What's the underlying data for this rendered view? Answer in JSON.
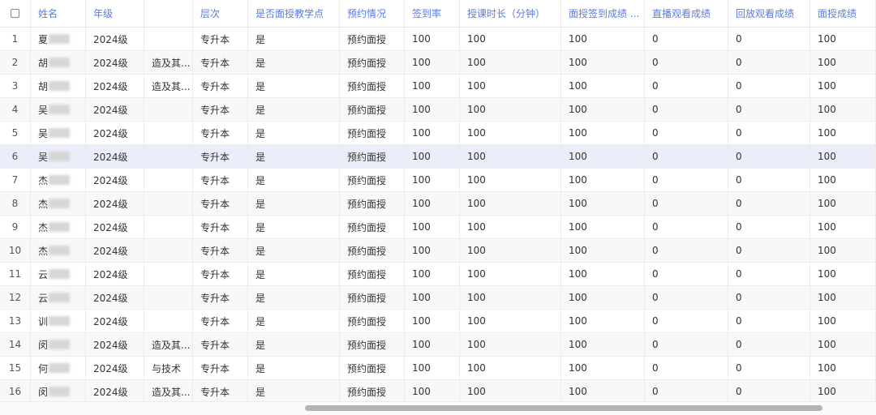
{
  "columns": [
    {
      "key": "checkbox",
      "label": ""
    },
    {
      "key": "name",
      "label": "姓名"
    },
    {
      "key": "grade",
      "label": "年级"
    },
    {
      "key": "major",
      "label": ""
    },
    {
      "key": "level",
      "label": "层次"
    },
    {
      "key": "is_site",
      "label": "是否面授教学点"
    },
    {
      "key": "booking",
      "label": "预约情况"
    },
    {
      "key": "signin_rate",
      "label": "签到率"
    },
    {
      "key": "duration",
      "label": "授课时长（分钟）"
    },
    {
      "key": "signin_score",
      "label": "面授签到成绩 ..."
    },
    {
      "key": "live_score",
      "label": "直播观看成绩"
    },
    {
      "key": "replay_score",
      "label": "回放观看成绩"
    },
    {
      "key": "face_score",
      "label": "面授成绩"
    }
  ],
  "rows": [
    {
      "idx": "1",
      "name": "夏",
      "grade": "2024级",
      "major": "",
      "level": "专升本",
      "is_site": "是",
      "booking": "预约面授",
      "signin_rate": "100",
      "duration": "100",
      "signin_score": "100",
      "live_score": "0",
      "replay_score": "0",
      "face_score": "100"
    },
    {
      "idx": "2",
      "name": "胡",
      "grade": "2024级",
      "major": "造及其...",
      "level": "专升本",
      "is_site": "是",
      "booking": "预约面授",
      "signin_rate": "100",
      "duration": "100",
      "signin_score": "100",
      "live_score": "0",
      "replay_score": "0",
      "face_score": "100"
    },
    {
      "idx": "3",
      "name": "胡",
      "grade": "2024级",
      "major": "造及其...",
      "level": "专升本",
      "is_site": "是",
      "booking": "预约面授",
      "signin_rate": "100",
      "duration": "100",
      "signin_score": "100",
      "live_score": "0",
      "replay_score": "0",
      "face_score": "100"
    },
    {
      "idx": "4",
      "name": "吴",
      "grade": "2024级",
      "major": "",
      "level": "专升本",
      "is_site": "是",
      "booking": "预约面授",
      "signin_rate": "100",
      "duration": "100",
      "signin_score": "100",
      "live_score": "0",
      "replay_score": "0",
      "face_score": "100"
    },
    {
      "idx": "5",
      "name": "吴",
      "grade": "2024级",
      "major": "",
      "level": "专升本",
      "is_site": "是",
      "booking": "预约面授",
      "signin_rate": "100",
      "duration": "100",
      "signin_score": "100",
      "live_score": "0",
      "replay_score": "0",
      "face_score": "100"
    },
    {
      "idx": "6",
      "name": "吴",
      "grade": "2024级",
      "major": "",
      "level": "专升本",
      "is_site": "是",
      "booking": "预约面授",
      "signin_rate": "100",
      "duration": "100",
      "signin_score": "100",
      "live_score": "0",
      "replay_score": "0",
      "face_score": "100"
    },
    {
      "idx": "7",
      "name": "杰",
      "grade": "2024级",
      "major": "",
      "level": "专升本",
      "is_site": "是",
      "booking": "预约面授",
      "signin_rate": "100",
      "duration": "100",
      "signin_score": "100",
      "live_score": "0",
      "replay_score": "0",
      "face_score": "100"
    },
    {
      "idx": "8",
      "name": "杰",
      "grade": "2024级",
      "major": "",
      "level": "专升本",
      "is_site": "是",
      "booking": "预约面授",
      "signin_rate": "100",
      "duration": "100",
      "signin_score": "100",
      "live_score": "0",
      "replay_score": "0",
      "face_score": "100"
    },
    {
      "idx": "9",
      "name": "杰",
      "grade": "2024级",
      "major": "",
      "level": "专升本",
      "is_site": "是",
      "booking": "预约面授",
      "signin_rate": "100",
      "duration": "100",
      "signin_score": "100",
      "live_score": "0",
      "replay_score": "0",
      "face_score": "100"
    },
    {
      "idx": "10",
      "name": "杰",
      "grade": "2024级",
      "major": "",
      "level": "专升本",
      "is_site": "是",
      "booking": "预约面授",
      "signin_rate": "100",
      "duration": "100",
      "signin_score": "100",
      "live_score": "0",
      "replay_score": "0",
      "face_score": "100"
    },
    {
      "idx": "11",
      "name": "云",
      "grade": "2024级",
      "major": "",
      "level": "专升本",
      "is_site": "是",
      "booking": "预约面授",
      "signin_rate": "100",
      "duration": "100",
      "signin_score": "100",
      "live_score": "0",
      "replay_score": "0",
      "face_score": "100"
    },
    {
      "idx": "12",
      "name": "云",
      "grade": "2024级",
      "major": "",
      "level": "专升本",
      "is_site": "是",
      "booking": "预约面授",
      "signin_rate": "100",
      "duration": "100",
      "signin_score": "100",
      "live_score": "0",
      "replay_score": "0",
      "face_score": "100"
    },
    {
      "idx": "13",
      "name": "训",
      "grade": "2024级",
      "major": "",
      "level": "专升本",
      "is_site": "是",
      "booking": "预约面授",
      "signin_rate": "100",
      "duration": "100",
      "signin_score": "100",
      "live_score": "0",
      "replay_score": "0",
      "face_score": "100"
    },
    {
      "idx": "14",
      "name": "闵",
      "grade": "2024级",
      "major": "造及其...",
      "level": "专升本",
      "is_site": "是",
      "booking": "预约面授",
      "signin_rate": "100",
      "duration": "100",
      "signin_score": "100",
      "live_score": "0",
      "replay_score": "0",
      "face_score": "100"
    },
    {
      "idx": "15",
      "name": "何",
      "grade": "2024级",
      "major": "与技术",
      "level": "专升本",
      "is_site": "是",
      "booking": "预约面授",
      "signin_rate": "100",
      "duration": "100",
      "signin_score": "100",
      "live_score": "0",
      "replay_score": "0",
      "face_score": "100"
    },
    {
      "idx": "16",
      "name": "闵",
      "grade": "2024级",
      "major": "造及其...",
      "level": "专升本",
      "is_site": "是",
      "booking": "预约面授",
      "signin_rate": "100",
      "duration": "100",
      "signin_score": "100",
      "live_score": "0",
      "replay_score": "0",
      "face_score": "100"
    }
  ],
  "selected_row": "6",
  "colors": {
    "header_text": "#5b7be3",
    "selected_row_bg": "#ebeef9",
    "alt_row_bg": "#f8f8f8"
  }
}
